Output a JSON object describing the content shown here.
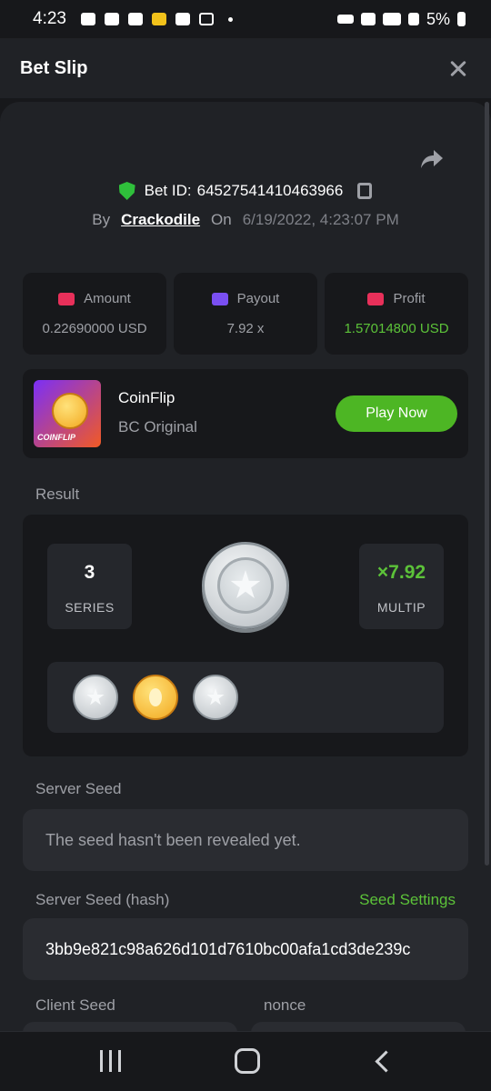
{
  "status_bar": {
    "time": "4:23",
    "battery": "5%"
  },
  "header": {
    "title": "Bet Slip"
  },
  "bet": {
    "id_label": "Bet ID:",
    "id_value": "64527541410463966",
    "by_label": "By",
    "user": "Crackodile",
    "on_label": "On",
    "date": "6/19/2022, 4:23:07 PM"
  },
  "stats": [
    {
      "label": "Amount",
      "value": "0.22690000 USD",
      "icon_color": "#e8305a"
    },
    {
      "label": "Payout",
      "value": "7.92 x",
      "icon_color": "#7a4ff2"
    },
    {
      "label": "Profit",
      "value": "1.57014800 USD",
      "icon_color": "#e8305a"
    }
  ],
  "game": {
    "name": "CoinFlip",
    "sub": "BC Original",
    "play_label": "Play Now",
    "thumb_label": "COINFLIP"
  },
  "result": {
    "label": "Result",
    "series_value": "3",
    "series_label": "SERIES",
    "multiplier_value": "×7.92",
    "multiplier_label": "MULTIP",
    "history": [
      "silver",
      "gold",
      "silver"
    ]
  },
  "server_seed": {
    "label": "Server Seed",
    "value": "The seed hasn't been revealed yet."
  },
  "server_seed_hash": {
    "label": "Server Seed (hash)",
    "settings_label": "Seed Settings",
    "value": "3bb9e821c98a626d101d7610bc00afa1cd3de239c"
  },
  "client_seed": {
    "label": "Client Seed"
  },
  "nonce": {
    "label": "nonce"
  },
  "colors": {
    "accent_green": "#4db624",
    "background": "#202226",
    "panel": "#17181b"
  }
}
